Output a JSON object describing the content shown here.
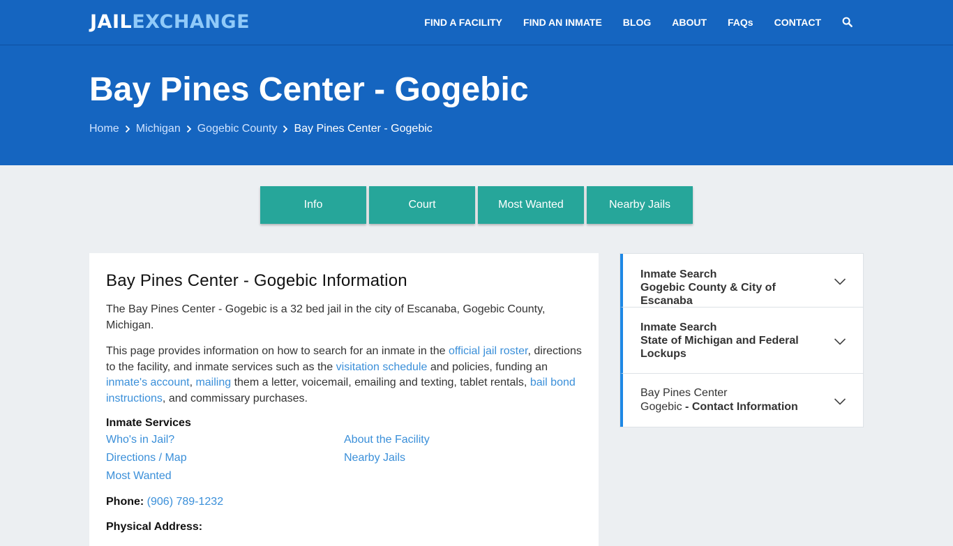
{
  "brand": {
    "part1": "JAIL",
    "part2": "EXCHANGE"
  },
  "nav": {
    "items": [
      "FIND A FACILITY",
      "FIND AN INMATE",
      "BLOG",
      "ABOUT",
      "FAQs",
      "CONTACT"
    ],
    "search_icon": "search-icon"
  },
  "hero": {
    "title": "Bay Pines Center - Gogebic",
    "breadcrumb": [
      "Home",
      "Michigan",
      "Gogebic County",
      "Bay Pines Center - Gogebic"
    ]
  },
  "tabs": [
    "Info",
    "Court",
    "Most Wanted",
    "Nearby Jails"
  ],
  "main": {
    "heading": "Bay Pines Center - Gogebic Information",
    "intro": "The Bay Pines Center - Gogebic is a 32 bed jail in the city of Escanaba, Gogebic County, Michigan.",
    "para2": {
      "t1": "This page provides information on how to search for an inmate in the ",
      "l1": "official jail roster",
      "t2": ", directions to the facility, and inmate services such as the ",
      "l2": "visitation schedule",
      "t3": " and policies, funding an ",
      "l3": "inmate's account",
      "t4": ", ",
      "l4": "mailing",
      "t5": " them a letter, voicemail, emailing and texting, tablet rentals, ",
      "l5": "bail bond instructions",
      "t6": ", and commissary purchases."
    },
    "services_heading": "Inmate Services",
    "services": {
      "whos_in_jail": "Who's in Jail?",
      "about": "About the Facility",
      "directions": "Directions / Map",
      "nearby": "Nearby Jails",
      "most_wanted": "Most Wanted"
    },
    "phone_label": "Phone:",
    "phone_value": "(906) 789-1232",
    "address_label": "Physical Address:"
  },
  "sidebar": {
    "acc1": {
      "line1": "Inmate Search",
      "line2": "Gogebic County & City of Escanaba"
    },
    "acc2": {
      "line1": "Inmate Search",
      "line2": "State of Michigan and Federal Lockups"
    },
    "acc3": {
      "line1": "Bay Pines Center",
      "line2a": "Gogebic",
      "line2b": " - Contact Information"
    }
  },
  "colors": {
    "primary": "#1565c0",
    "accent": "#26a69a",
    "link": "#3a8fd9",
    "logo_light": "#90caf9"
  }
}
